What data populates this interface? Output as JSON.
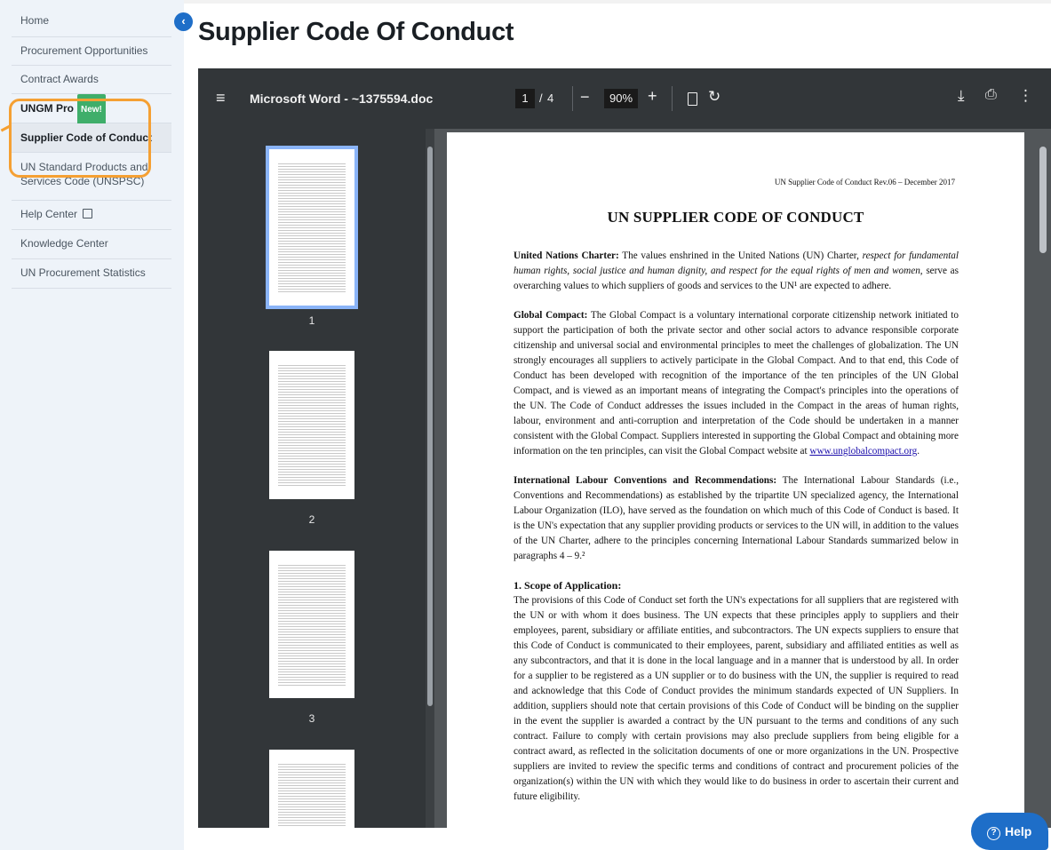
{
  "sidebar": {
    "items": [
      {
        "label": "Home"
      },
      {
        "label": "Procurement Opportunities"
      },
      {
        "label": "Contract Awards"
      },
      {
        "label": "UNGM Pro",
        "badge": "New!"
      },
      {
        "label": "Supplier Code of Conduct"
      },
      {
        "label": "UN Standard Products and Services Code (UNSPSC)"
      },
      {
        "label": "Help Center"
      },
      {
        "label": "Knowledge Center"
      },
      {
        "label": "UN Procurement Statistics"
      }
    ],
    "collapse_icon": "‹"
  },
  "page": {
    "title": "Supplier Code Of Conduct"
  },
  "viewer": {
    "menu_icon": "≡",
    "file_title": "Microsoft Word - ~1375594.doc",
    "current_page": "1",
    "page_separator": "/",
    "total_pages": "4",
    "zoom_out": "−",
    "zoom": "90%",
    "zoom_in": "+",
    "rotate_icon": "↻",
    "download_icon": "⤓",
    "print_icon": "⎙",
    "more_icon": "⋮",
    "thumbnails": [
      "1",
      "2",
      "3"
    ]
  },
  "document": {
    "header": "UN Supplier Code of Conduct Rev.06 – December 2017",
    "title": "UN SUPPLIER CODE OF CONDUCT",
    "p1_lead": "United Nations Charter:",
    "p1_a": " The values enshrined in the United Nations (UN) Charter, ",
    "p1_em": "respect for fundamental human rights, social justice and human dignity, and respect for the equal rights of men and women",
    "p1_b": ", serve as overarching values to which suppliers of goods and services to the UN¹ are expected to adhere.",
    "p2_lead": "Global Compact:",
    "p2_text": " The Global Compact is a voluntary international corporate citizenship network initiated to support the participation of both the private sector and other social actors to advance responsible corporate citizenship and universal social and environmental principles to meet the challenges of globalization. The UN strongly encourages all suppliers to actively participate in the Global Compact. And to that end, this Code of Conduct has been developed with recognition of the importance of the ten principles of the UN Global Compact, and is viewed as an important means of integrating the Compact's principles into the operations of the UN. The Code of Conduct addresses the issues included in the Compact in the areas of human rights, labour, environment and anti-corruption and interpretation of the Code should be undertaken in a manner consistent with the Global Compact. Suppliers interested in supporting the Global Compact and obtaining more information on the ten principles, can visit the Global Compact website at ",
    "p2_link": "www.unglobalcompact.org",
    "p2_end": ".",
    "p3_lead": "International Labour Conventions and Recommendations:",
    "p3_text": " The International Labour Standards (i.e., Conventions and Recommendations) as established by the tripartite UN specialized agency, the International Labour Organization (ILO), have served as the foundation on which much of this Code of Conduct is based. It is the UN's expectation that any supplier providing products or services to the UN will, in addition to the values of the UN Charter, adhere to the principles concerning International Labour Standards summarized below in paragraphs 4 – 9.²",
    "s1_heading": "1. Scope of Application:",
    "s1_text": "The provisions of this Code of Conduct set forth the UN's expectations for all suppliers that are registered with the UN or with whom it does business. The UN expects that these principles apply to suppliers and their employees, parent, subsidiary or affiliate entities, and subcontractors. The UN expects suppliers to ensure that this Code of Conduct is communicated to their employees, parent, subsidiary and affiliated entities as well as any subcontractors, and that it is done in the local language and in a manner that is understood by all. In order for a supplier to be registered as a UN supplier or to do business with the UN, the supplier is required to read and acknowledge that this Code of Conduct provides the minimum standards expected of UN Suppliers. In addition, suppliers should note that certain provisions of this Code of Conduct will be binding on the supplier in the event the supplier is awarded a contract by the UN pursuant to the terms and conditions of any such contract. Failure to comply with certain provisions may also preclude suppliers from being eligible for a contract award, as reflected in the solicitation documents of one or more organizations in the UN. Prospective suppliers are invited to review the specific terms and conditions of contract and procurement policies of the organization(s) within the UN with which they would like to do business in order to ascertain their current and future eligibility."
  },
  "help": {
    "icon": "?",
    "label": "Help"
  }
}
